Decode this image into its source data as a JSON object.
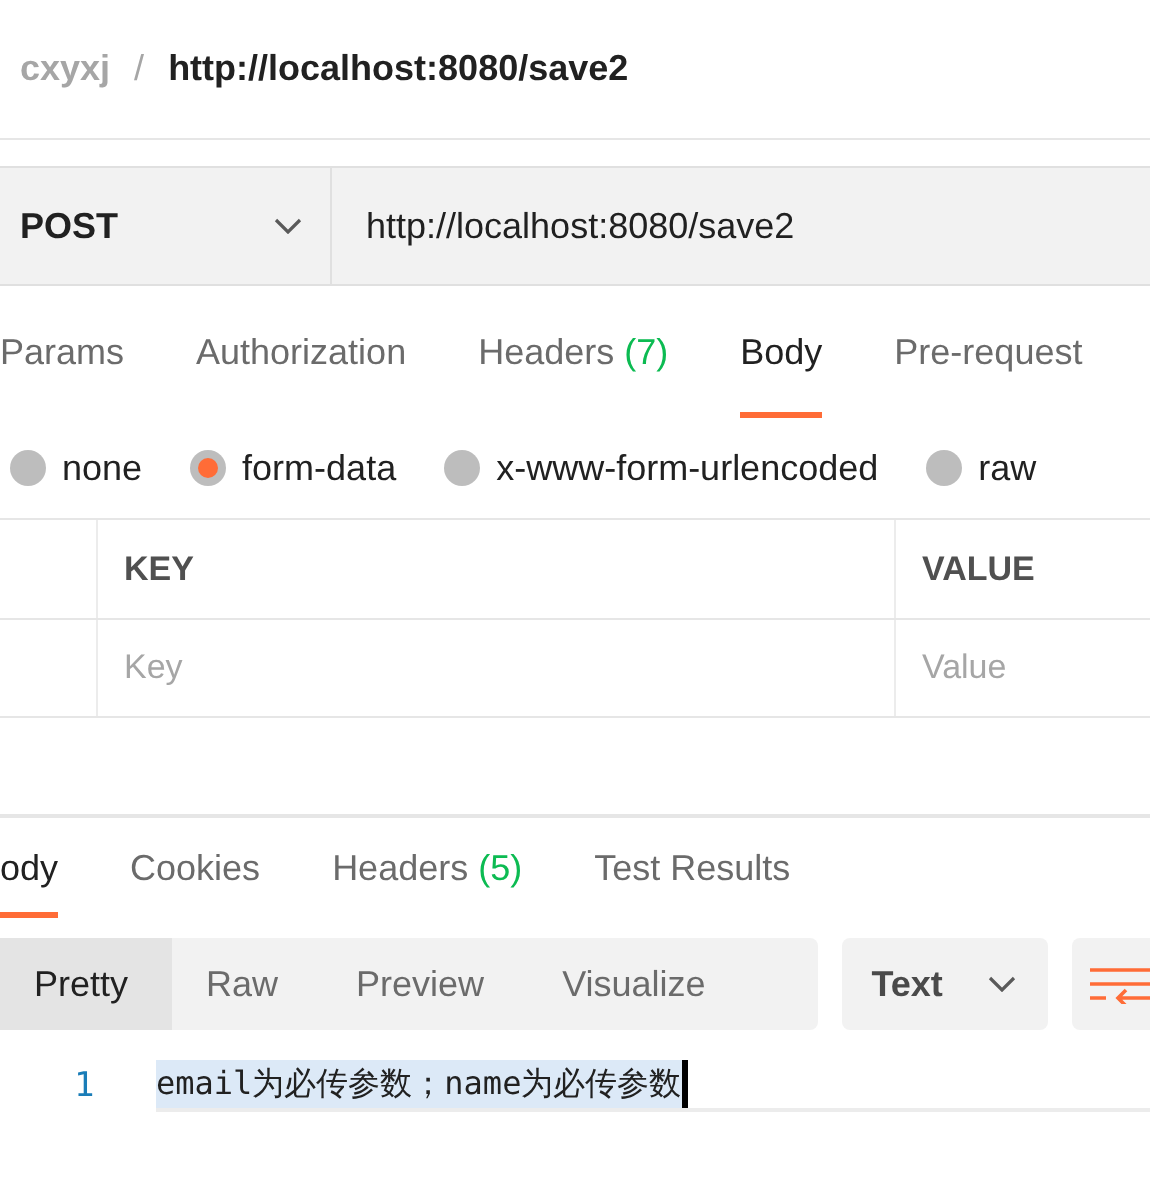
{
  "breadcrumb": {
    "workspace": "cxyxj",
    "separator": "/",
    "request": "http://localhost:8080/save2"
  },
  "request": {
    "method": "POST",
    "url": "http://localhost:8080/save2"
  },
  "request_tabs": [
    {
      "label": "Params",
      "selected": false
    },
    {
      "label": "Authorization",
      "selected": false
    },
    {
      "label": "Headers",
      "count": "(7)",
      "selected": false
    },
    {
      "label": "Body",
      "selected": true
    },
    {
      "label": "Pre-request",
      "selected": false
    }
  ],
  "body_types": [
    {
      "label": "none",
      "selected": false
    },
    {
      "label": "form-data",
      "selected": true
    },
    {
      "label": "x-www-form-urlencoded",
      "selected": false
    },
    {
      "label": "raw",
      "selected": false
    }
  ],
  "params_table": {
    "columns": [
      "KEY",
      "VALUE"
    ],
    "rows": [
      {
        "key_placeholder": "Key",
        "value_placeholder": "Value"
      }
    ]
  },
  "response_tabs": [
    {
      "label": "ody",
      "selected": true
    },
    {
      "label": "Cookies",
      "selected": false
    },
    {
      "label": "Headers",
      "count": "(5)",
      "selected": false
    },
    {
      "label": "Test Results",
      "selected": false
    }
  ],
  "view_modes": [
    {
      "label": "Pretty",
      "selected": true
    },
    {
      "label": "Raw",
      "selected": false
    },
    {
      "label": "Preview",
      "selected": false
    },
    {
      "label": "Visualize",
      "selected": false
    }
  ],
  "format": "Text",
  "editor": {
    "lines": [
      {
        "number": "1",
        "text": "email为必传参数；name为必传参数"
      }
    ]
  }
}
